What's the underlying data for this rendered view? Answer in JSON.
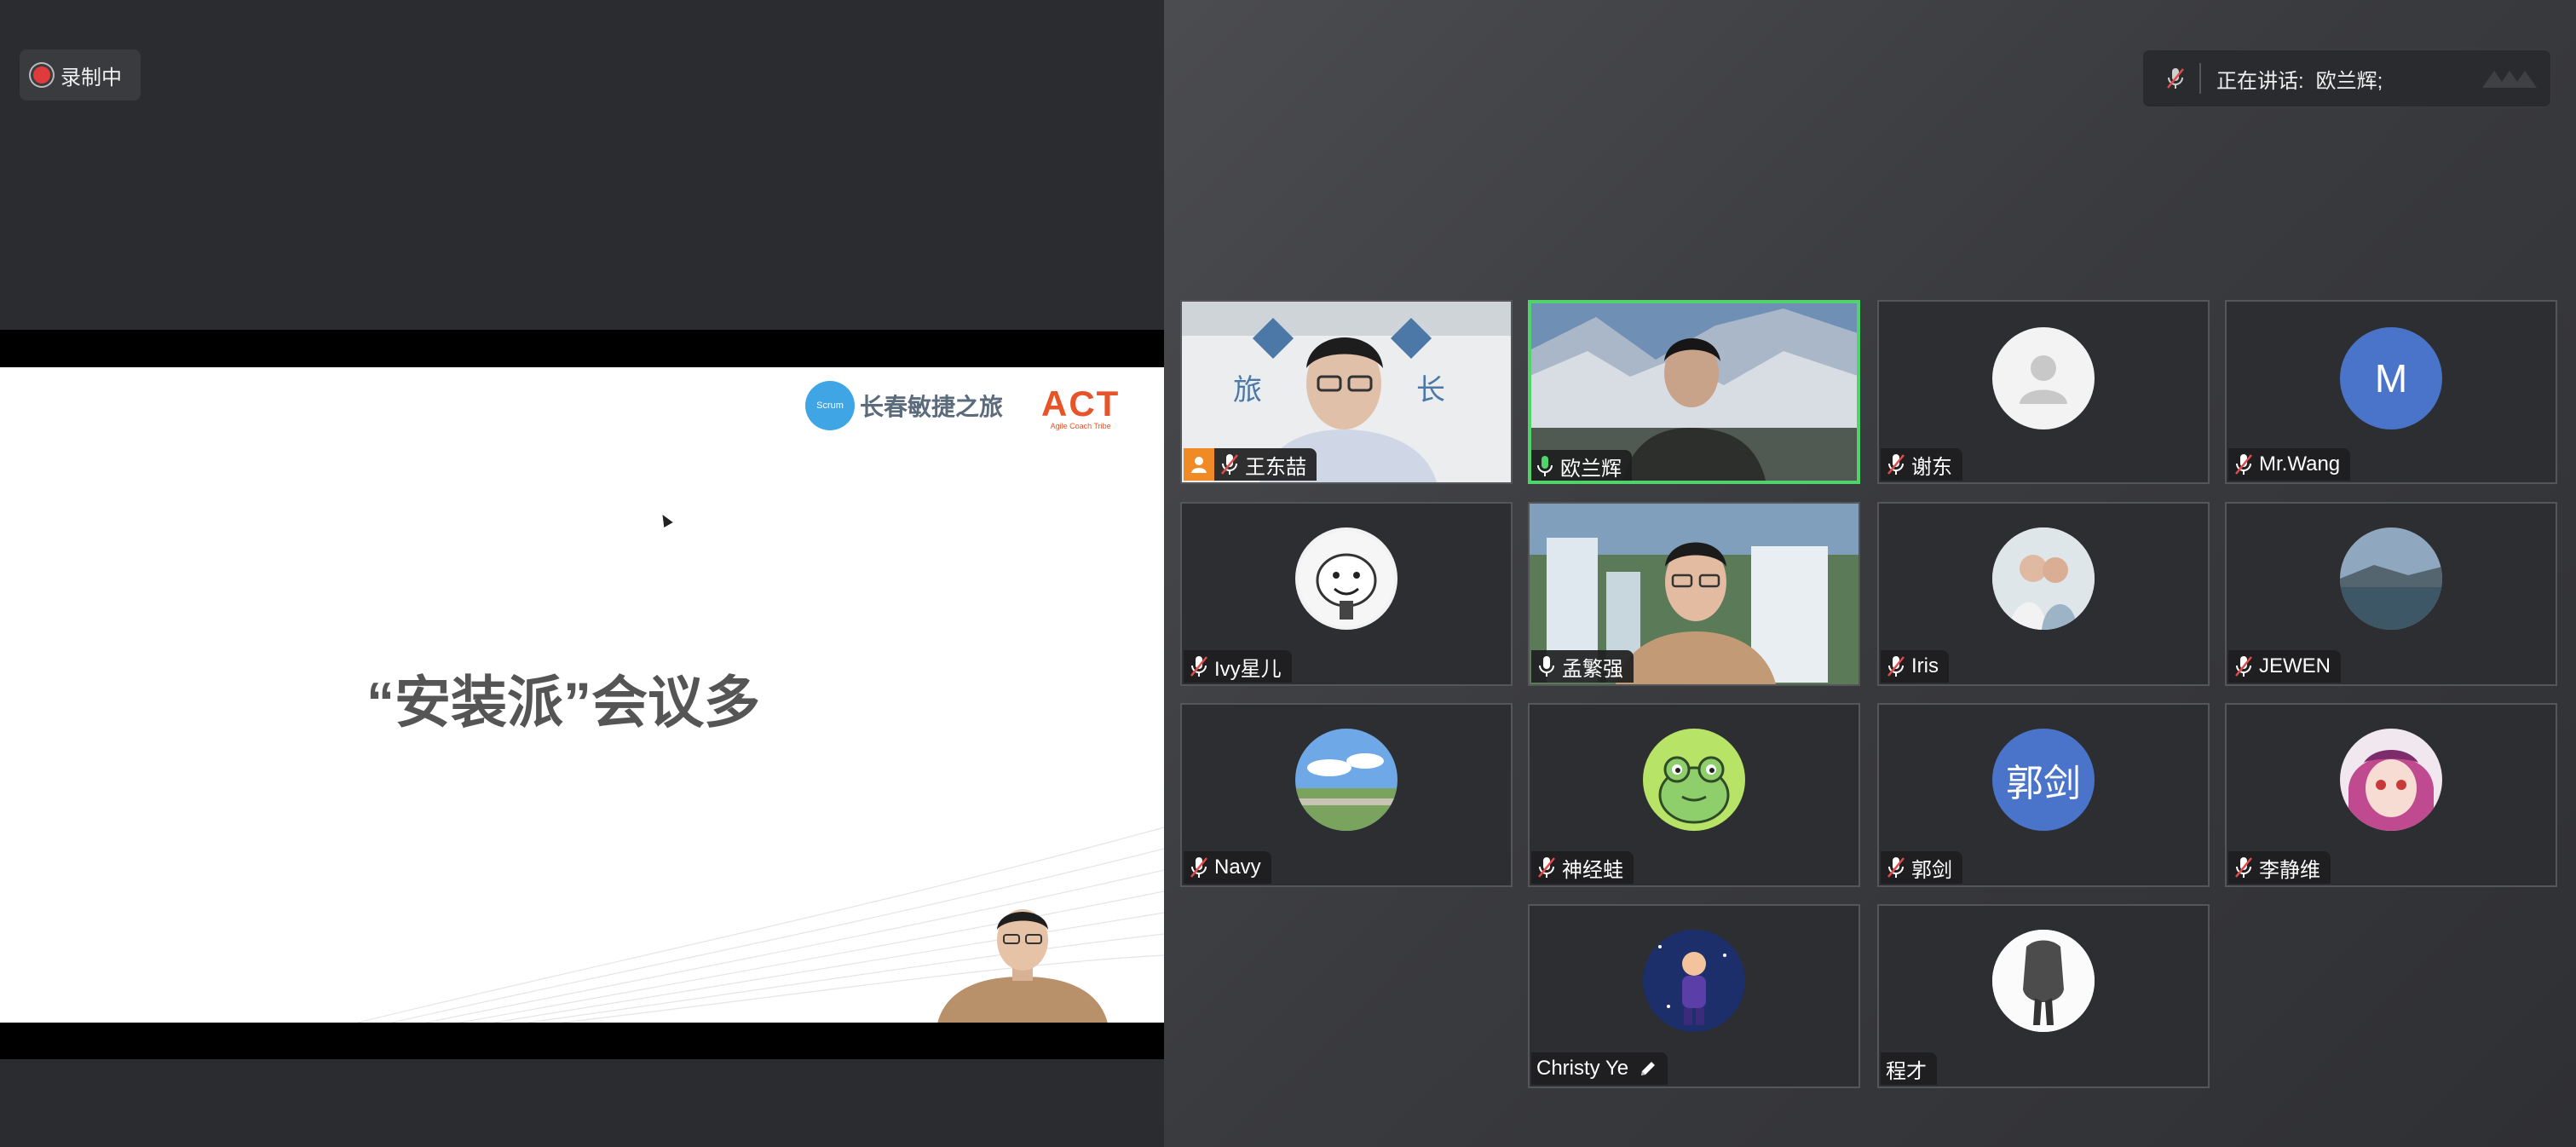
{
  "recording": {
    "label": "录制中"
  },
  "speaking": {
    "prefix": "正在讲话:",
    "name": "欧兰辉;"
  },
  "slide": {
    "brand_text": "长春敏捷之旅",
    "brand_logo_small": "Scrum",
    "act_main": "ACT",
    "act_sub": "Agile Coach Tribe",
    "title": "“安装派”会议多"
  },
  "participants": [
    {
      "name": "王东喆",
      "type": "video",
      "muted": true,
      "host": true
    },
    {
      "name": "欧兰辉",
      "type": "video",
      "muted": false,
      "active": true
    },
    {
      "name": "谢东",
      "type": "avatar",
      "muted": true
    },
    {
      "name": "Mr.Wang",
      "type": "avatar",
      "initial": "M",
      "muted": true
    },
    {
      "name": "Ivy星儿",
      "type": "avatar",
      "muted": true
    },
    {
      "name": "孟繁强",
      "type": "video",
      "muted": false
    },
    {
      "name": "Iris",
      "type": "avatar",
      "muted": true
    },
    {
      "name": "JEWEN",
      "type": "avatar",
      "muted": true
    },
    {
      "name": "Navy",
      "type": "avatar",
      "muted": true
    },
    {
      "name": "神经蛙",
      "type": "avatar",
      "muted": true
    },
    {
      "name": "郭剑",
      "type": "avatar",
      "initial": "郭剑",
      "muted": true
    },
    {
      "name": "李静维",
      "type": "avatar",
      "muted": true
    },
    {
      "name": "Christy Ye",
      "type": "avatar",
      "editing": true
    },
    {
      "name": "程才",
      "type": "avatar"
    }
  ],
  "colors": {
    "active_border": "#4fd36a",
    "mic_muted": "#e24b4b",
    "host_badge": "#f08a24",
    "avatar_blue": "#4a74c9"
  }
}
